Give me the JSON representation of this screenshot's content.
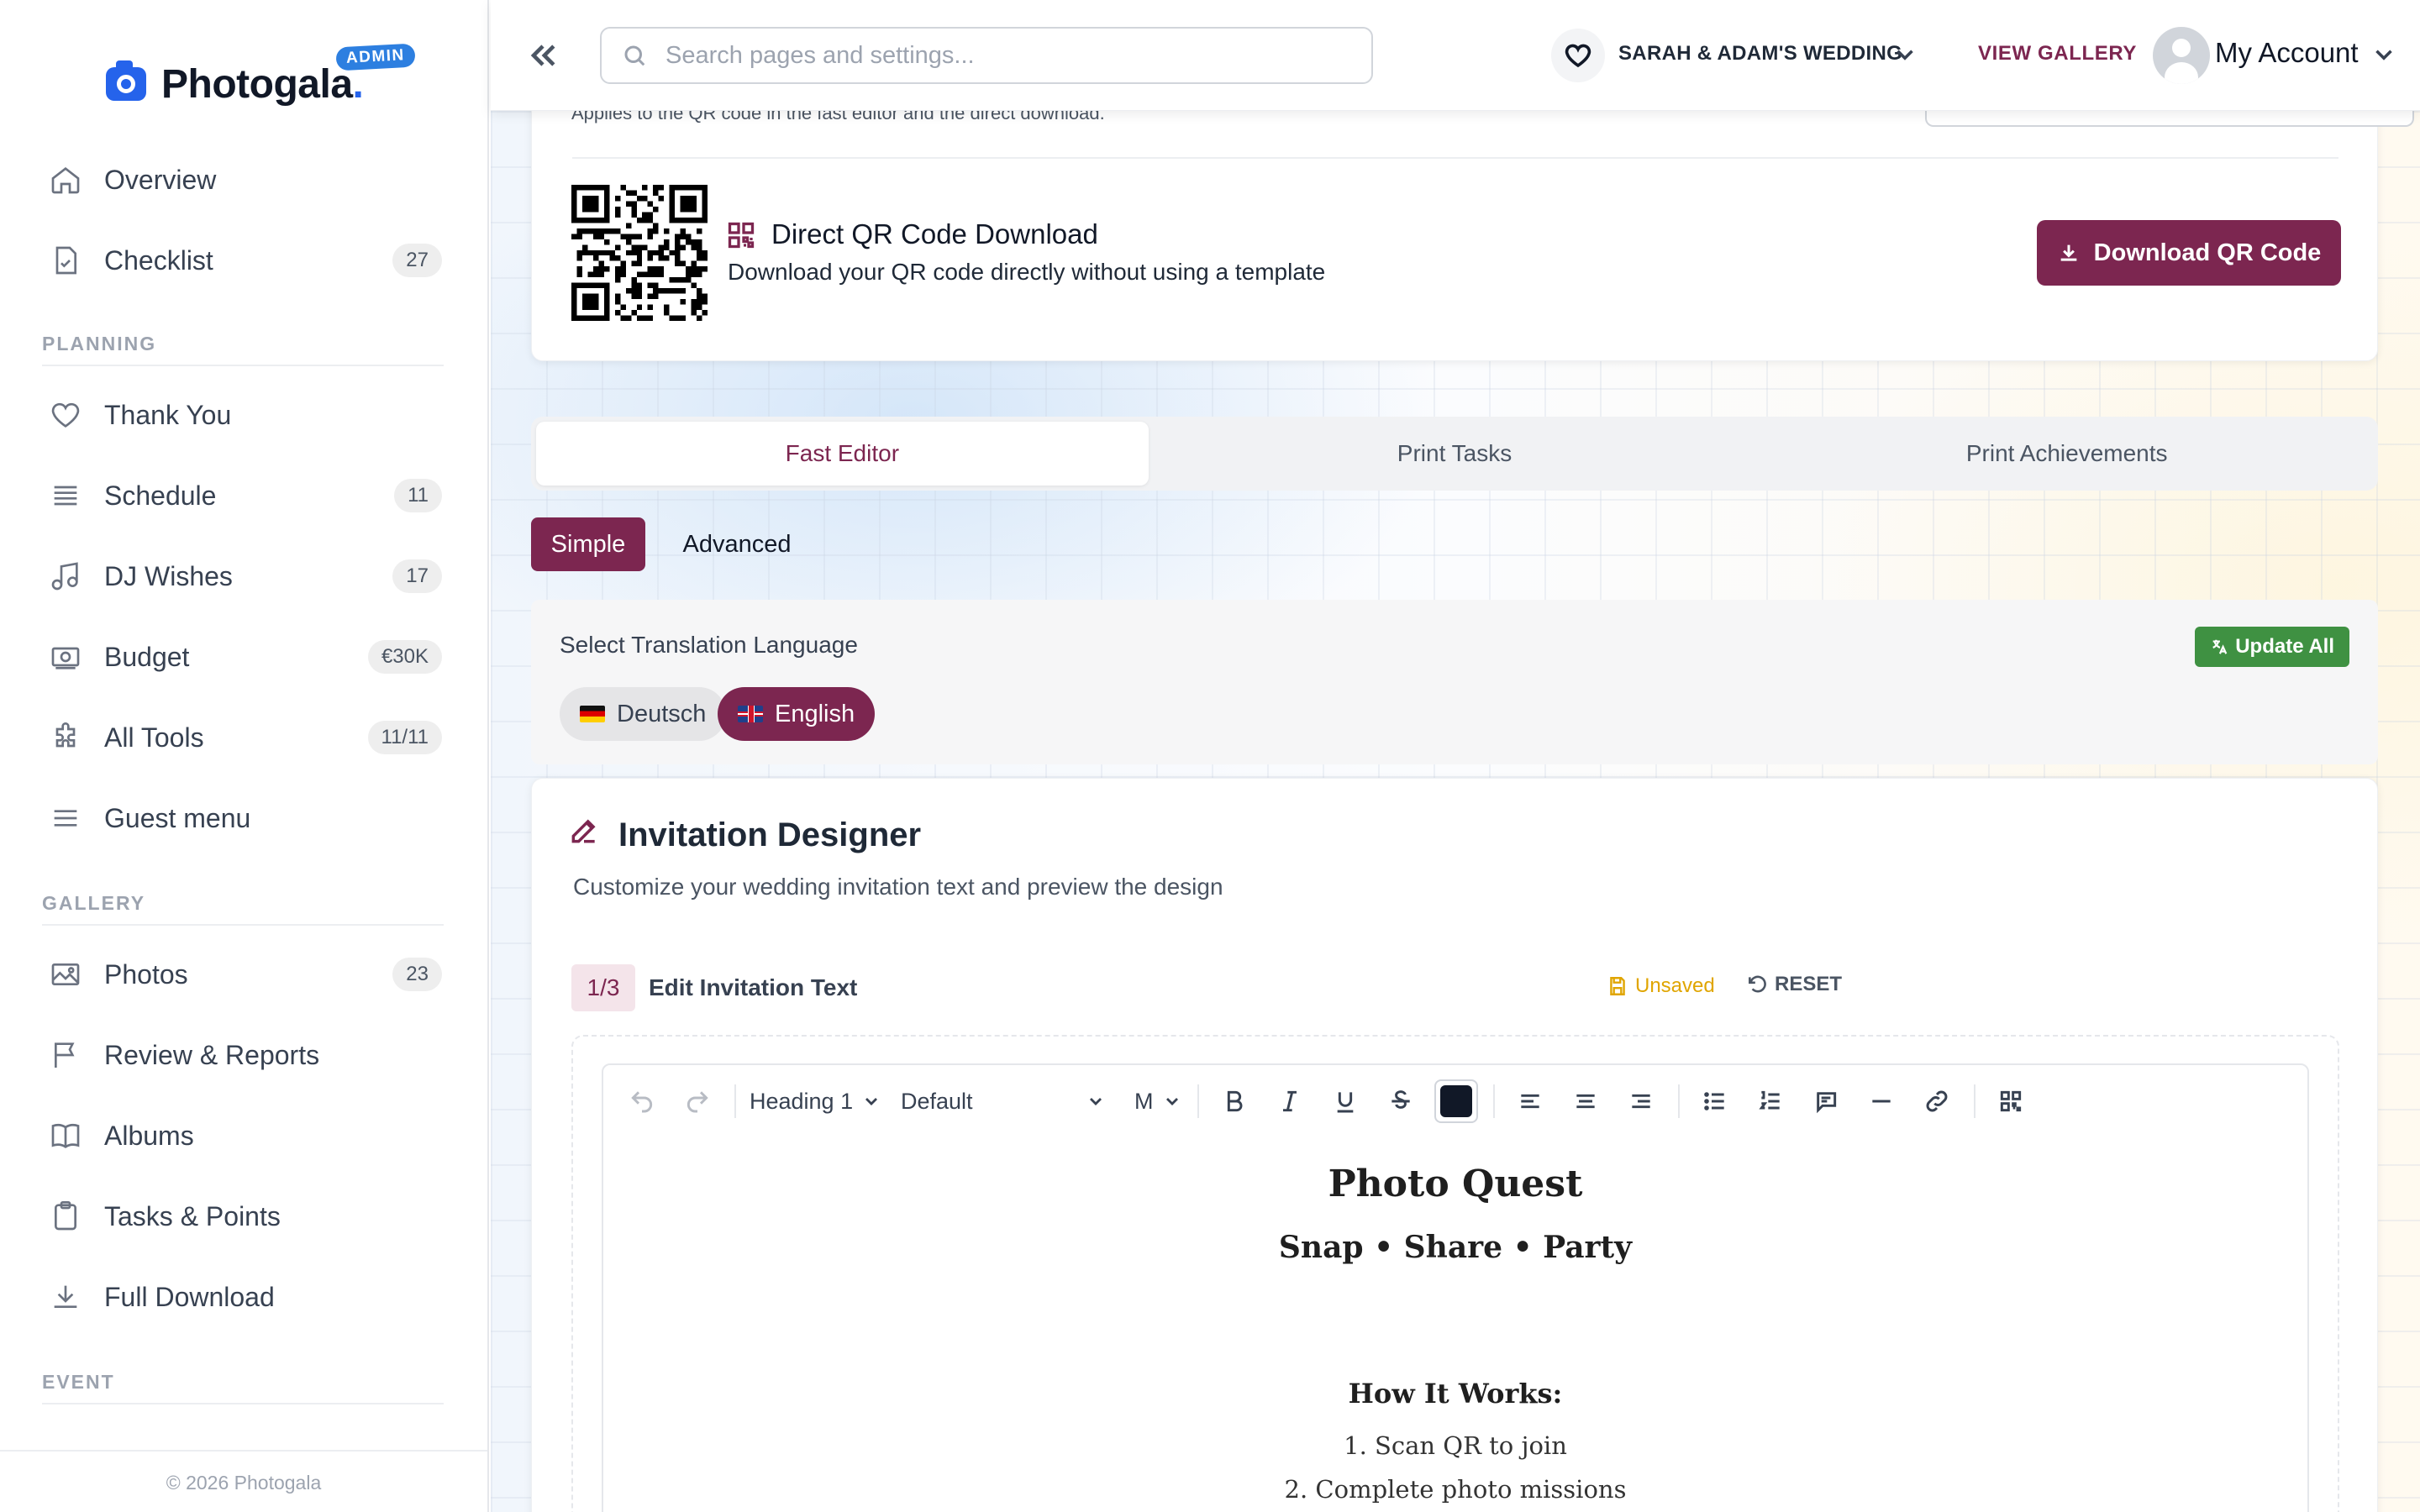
{
  "brand": {
    "name": "Photogala",
    "dot": ".",
    "badge": "ADMIN"
  },
  "sidebar": {
    "items": [
      {
        "label": "Overview",
        "icon": "home-icon"
      },
      {
        "label": "Checklist",
        "icon": "checklist-icon",
        "badge": "27"
      },
      {
        "label": "Thank You",
        "icon": "heart-icon"
      },
      {
        "label": "Schedule",
        "icon": "schedule-icon",
        "badge": "11"
      },
      {
        "label": "DJ Wishes",
        "icon": "music-icon",
        "badge": "17"
      },
      {
        "label": "Budget",
        "icon": "money-icon",
        "badge": "€30K"
      },
      {
        "label": "All Tools",
        "icon": "puzzle-icon",
        "badge": "11/11"
      },
      {
        "label": "Guest menu",
        "icon": "menu-icon"
      },
      {
        "label": "Photos",
        "icon": "image-icon",
        "badge": "23"
      },
      {
        "label": "Review & Reports",
        "icon": "flag-icon"
      },
      {
        "label": "Albums",
        "icon": "book-icon"
      },
      {
        "label": "Tasks & Points",
        "icon": "clipboard-icon"
      },
      {
        "label": "Full Download",
        "icon": "download-icon"
      }
    ],
    "sections": {
      "planning": "PLANNING",
      "gallery": "GALLERY",
      "event": "EVENT"
    },
    "footer": "© 2026 Photogala"
  },
  "topbar": {
    "search_placeholder": "Search pages and settings...",
    "event_name": "SARAH & ADAM'S WEDDING",
    "view_gallery": "VIEW GALLERY",
    "account": "My Account"
  },
  "qr": {
    "applies_text": "Applies to the QR code in the fast editor and the direct download.",
    "title": "Direct QR Code Download",
    "description": "Download your QR code directly without using a template",
    "button": "Download QR Code"
  },
  "tabs": [
    {
      "label": "Fast Editor",
      "active": true
    },
    {
      "label": "Print Tasks",
      "active": false
    },
    {
      "label": "Print Achievements",
      "active": false
    }
  ],
  "modes": {
    "simple": "Simple",
    "advanced": "Advanced"
  },
  "translation": {
    "title": "Select Translation Language",
    "update_all": "Update All",
    "languages": [
      {
        "label": "Deutsch",
        "selected": false
      },
      {
        "label": "English",
        "selected": true
      }
    ]
  },
  "designer": {
    "title": "Invitation Designer",
    "subtitle": "Customize your wedding invitation text and preview the design",
    "step": "1/3",
    "step_title": "Edit Invitation Text",
    "unsaved": "Unsaved",
    "reset": "RESET"
  },
  "toolbar": {
    "heading": "Heading 1",
    "font": "Default",
    "size": "M",
    "text_color": "#111827"
  },
  "document": {
    "title": "Photo Quest",
    "subtitle": "Snap • Share • Party",
    "how_title": "How It Works:",
    "steps": [
      "1. Scan QR to join",
      "2. Complete photo missions"
    ]
  },
  "colors": {
    "accent": "#7c2650",
    "brand_blue": "#2563eb",
    "success": "#3f9142",
    "warning": "#e0a500"
  }
}
